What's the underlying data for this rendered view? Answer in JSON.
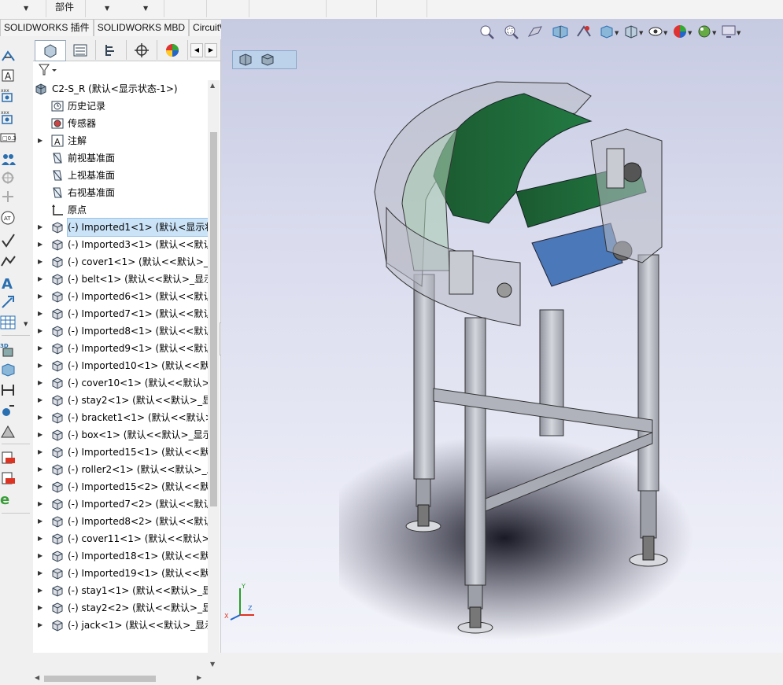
{
  "ribbon": {
    "fragment_label": "部件",
    "tabs": [
      "SOLIDWORKS 插件",
      "SOLIDWORKS MBD",
      "CircuitWorks"
    ]
  },
  "feature_manager": {
    "root": "C2-S_R  (默认<显示状态-1>)",
    "items": [
      {
        "expand": false,
        "icon": "history-icon",
        "label": "历史记录"
      },
      {
        "expand": false,
        "icon": "sensor-icon",
        "label": "传感器"
      },
      {
        "expand": true,
        "icon": "annotation-icon",
        "label": "注解"
      },
      {
        "expand": false,
        "icon": "plane-icon",
        "label": "前视基准面"
      },
      {
        "expand": false,
        "icon": "plane-icon",
        "label": "上视基准面"
      },
      {
        "expand": false,
        "icon": "plane-icon",
        "label": "右视基准面"
      },
      {
        "expand": false,
        "icon": "origin-icon",
        "label": "原点"
      },
      {
        "expand": true,
        "icon": "part-icon",
        "label": "(-) Imported1<1> (默认<显示状",
        "selected": true
      },
      {
        "expand": true,
        "icon": "part-icon",
        "label": "(-) Imported3<1> (默认<<默认"
      },
      {
        "expand": true,
        "icon": "part-icon",
        "label": "(-) cover1<1> (默认<<默认>_显"
      },
      {
        "expand": true,
        "icon": "part-icon",
        "label": "(-) belt<1> (默认<<默认>_显示"
      },
      {
        "expand": true,
        "icon": "part-icon",
        "label": "(-) Imported6<1> (默认<<默认"
      },
      {
        "expand": true,
        "icon": "part-icon",
        "label": "(-) Imported7<1> (默认<<默认"
      },
      {
        "expand": true,
        "icon": "part-icon",
        "label": "(-) Imported8<1> (默认<<默认"
      },
      {
        "expand": true,
        "icon": "part-icon",
        "label": "(-) Imported9<1> (默认<<默认"
      },
      {
        "expand": true,
        "icon": "part-icon",
        "label": "(-) Imported10<1> (默认<<默"
      },
      {
        "expand": true,
        "icon": "part-icon",
        "label": "(-) cover10<1> (默认<<默认>_"
      },
      {
        "expand": true,
        "icon": "part-icon",
        "label": "(-) stay2<1> (默认<<默认>_显"
      },
      {
        "expand": true,
        "icon": "part-icon",
        "label": "(-) bracket1<1> (默认<<默认>"
      },
      {
        "expand": true,
        "icon": "part-icon",
        "label": "(-) box<1> (默认<<默认>_显示"
      },
      {
        "expand": true,
        "icon": "part-icon",
        "label": "(-) Imported15<1> (默认<<默"
      },
      {
        "expand": true,
        "icon": "part-icon",
        "label": "(-) roller2<1> (默认<<默认>_显"
      },
      {
        "expand": true,
        "icon": "part-icon",
        "label": "(-) Imported15<2> (默认<<默"
      },
      {
        "expand": true,
        "icon": "part-icon",
        "label": "(-) Imported7<2> (默认<<默认"
      },
      {
        "expand": true,
        "icon": "part-icon",
        "label": "(-) Imported8<2> (默认<<默认"
      },
      {
        "expand": true,
        "icon": "part-icon",
        "label": "(-) cover11<1> (默认<<默认>_"
      },
      {
        "expand": true,
        "icon": "part-icon",
        "label": "(-) Imported18<1> (默认<<默"
      },
      {
        "expand": true,
        "icon": "part-icon",
        "label": "(-) Imported19<1> (默认<<默"
      },
      {
        "expand": true,
        "icon": "part-icon",
        "label": "(-) stay1<1> (默认<<默认>_显"
      },
      {
        "expand": true,
        "icon": "part-icon",
        "label": "(-) stay2<2> (默认<<默认>_显"
      },
      {
        "expand": true,
        "icon": "part-icon",
        "label": "(-) jack<1> (默认<<默认>_显示"
      }
    ]
  },
  "viewport": {
    "belt_color": "#1f6e3c",
    "frame_color": "#b9bbc6",
    "triad_labels": {
      "x": "X",
      "y": "Y",
      "z": "Z"
    }
  }
}
